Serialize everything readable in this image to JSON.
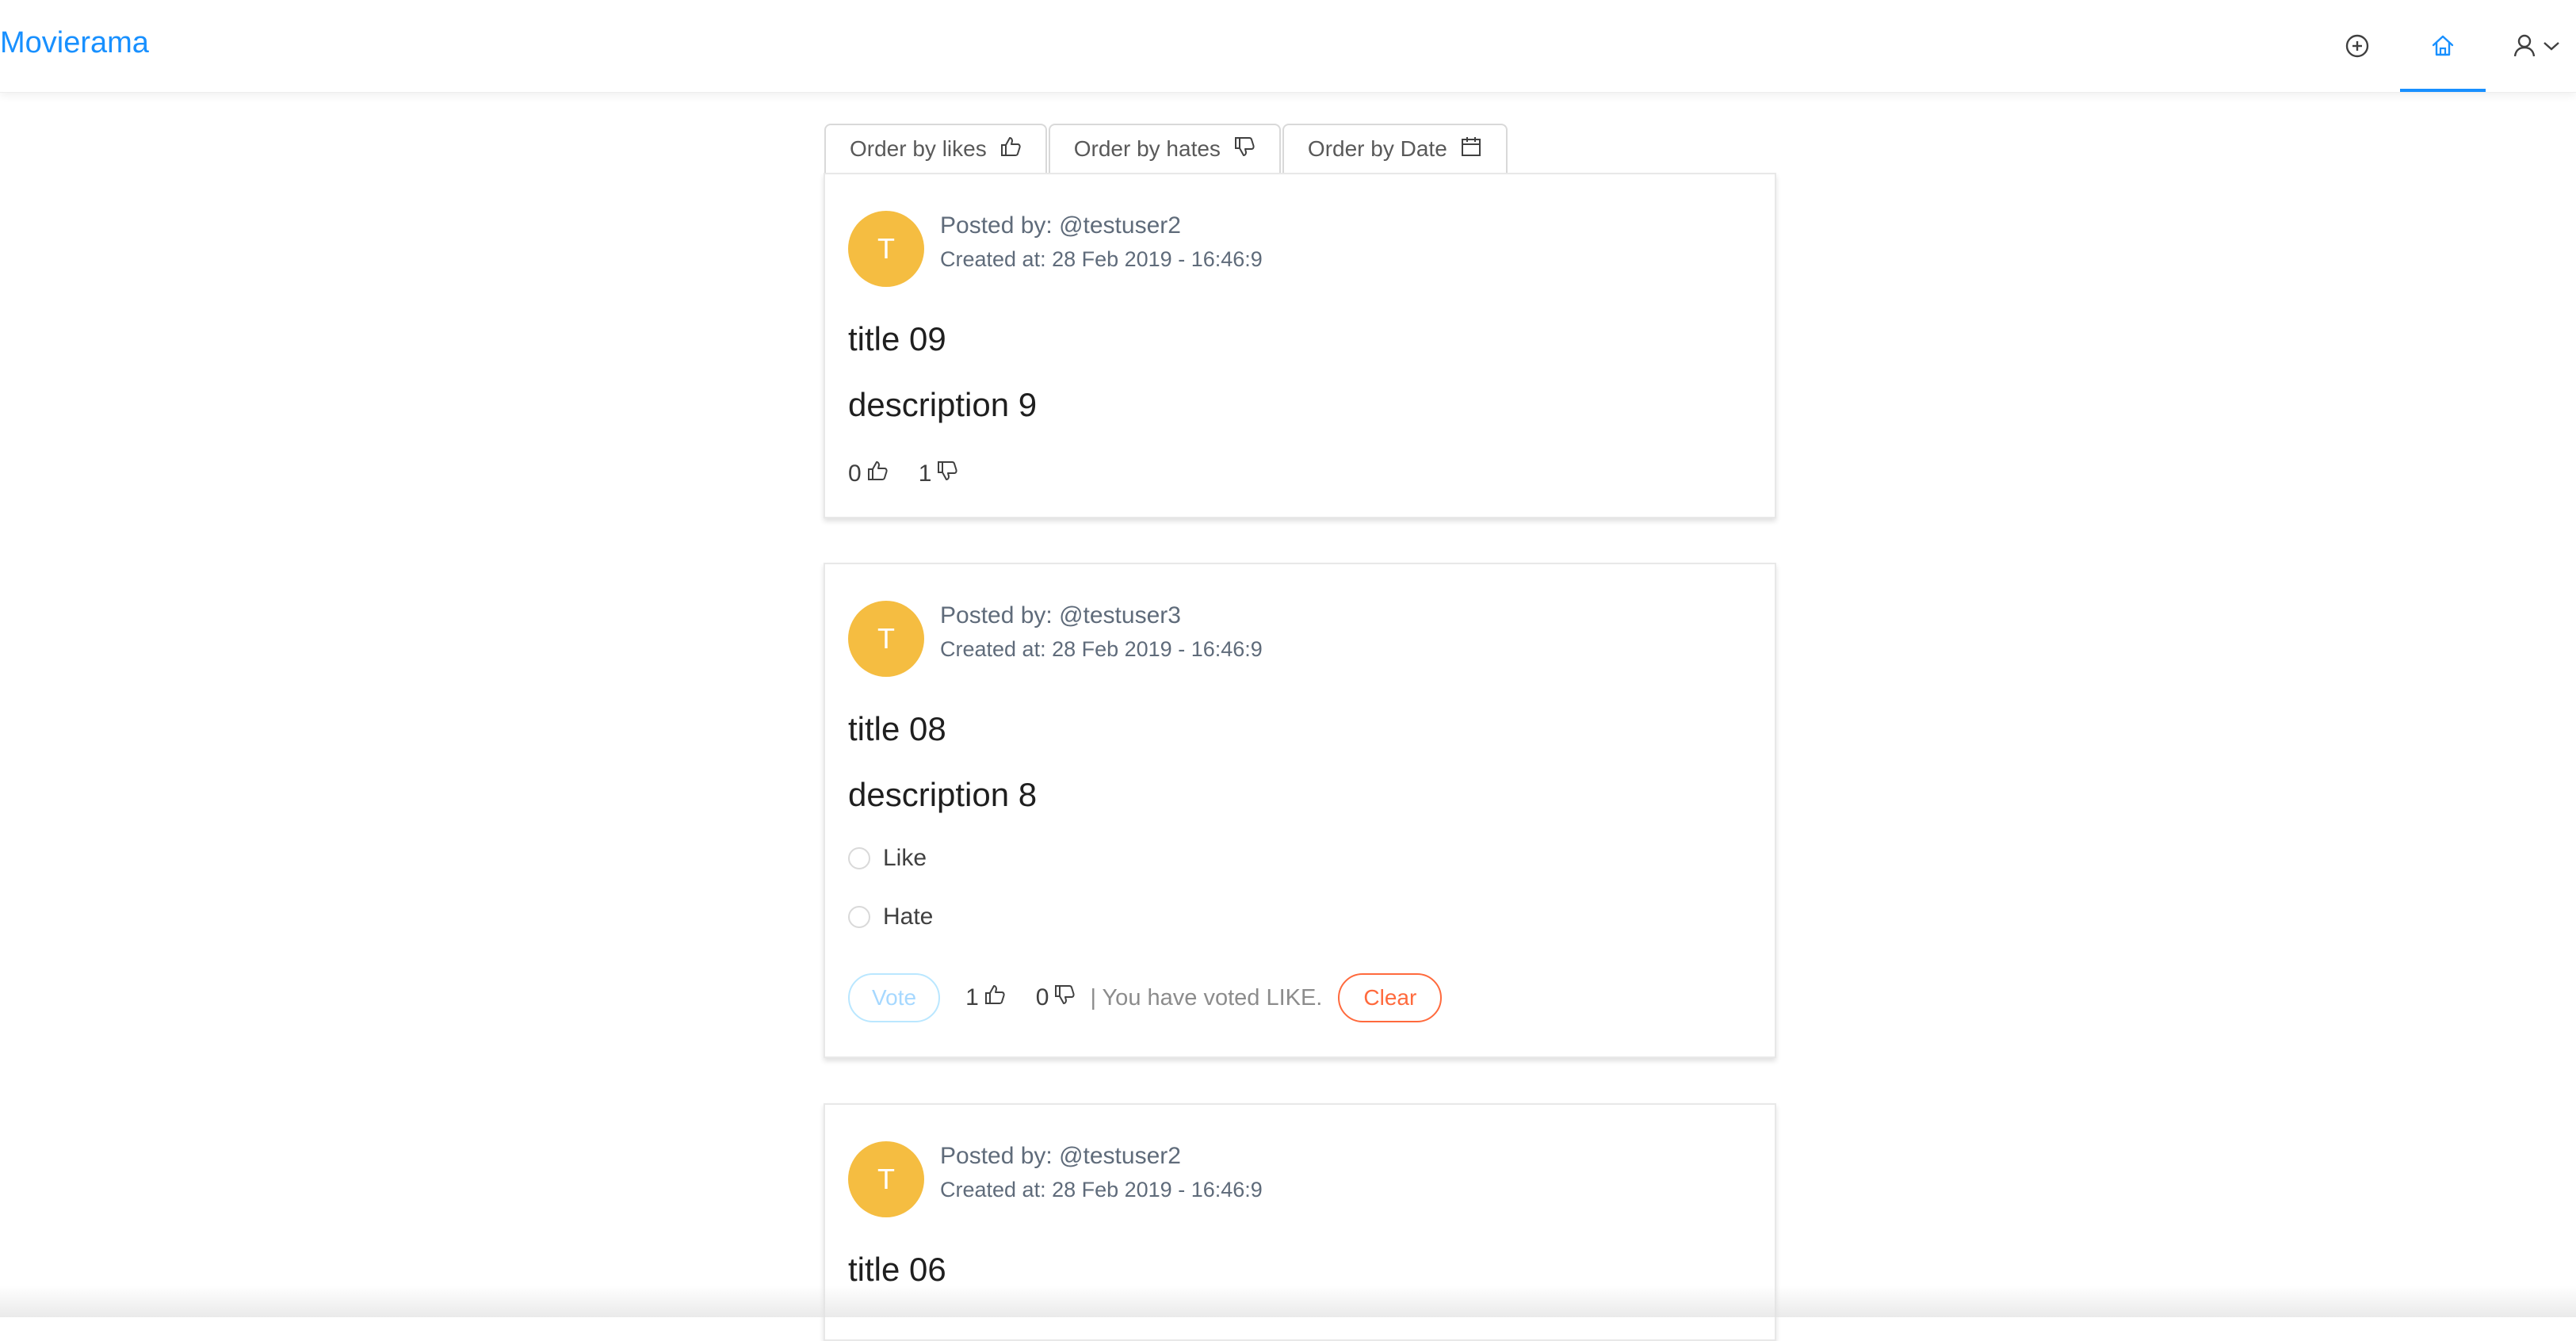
{
  "header": {
    "logo": "Movierama",
    "nav": {
      "add_icon": "plus-circle-icon",
      "home_icon": "home-icon",
      "user_icon": "user-icon",
      "dropdown_icon": "chevron-down-icon"
    }
  },
  "order_buttons": [
    {
      "label": "Order by likes",
      "icon": "thumbs-up-icon"
    },
    {
      "label": "Order by hates",
      "icon": "thumbs-down-icon"
    },
    {
      "label": "Order by Date",
      "icon": "calendar-icon"
    }
  ],
  "posts": [
    {
      "avatar_letter": "T",
      "posted_by": "Posted by: @testuser2",
      "created_at": "Created at: 28 Feb 2019 - 16:46:9",
      "title": "title 09",
      "description": "description 9",
      "likes": "0",
      "hates": "1"
    },
    {
      "avatar_letter": "T",
      "posted_by": "Posted by: @testuser3",
      "created_at": "Created at: 28 Feb 2019 - 16:46:9",
      "title": "title 08",
      "description": "description 8",
      "options": [
        "Like",
        "Hate"
      ],
      "vote_label": "Vote",
      "likes": "1",
      "hates": "0",
      "voted_text": "| You have voted LIKE.",
      "clear_label": "Clear"
    },
    {
      "avatar_letter": "T",
      "posted_by": "Posted by: @testuser2",
      "created_at": "Created at: 28 Feb 2019 - 16:46:9",
      "title": "title 06"
    }
  ],
  "colors": {
    "brand": "#1890ff",
    "avatar": "#f5bd41",
    "clear": "#ff6a3d",
    "vote_disabled": "#a6d8ff"
  }
}
